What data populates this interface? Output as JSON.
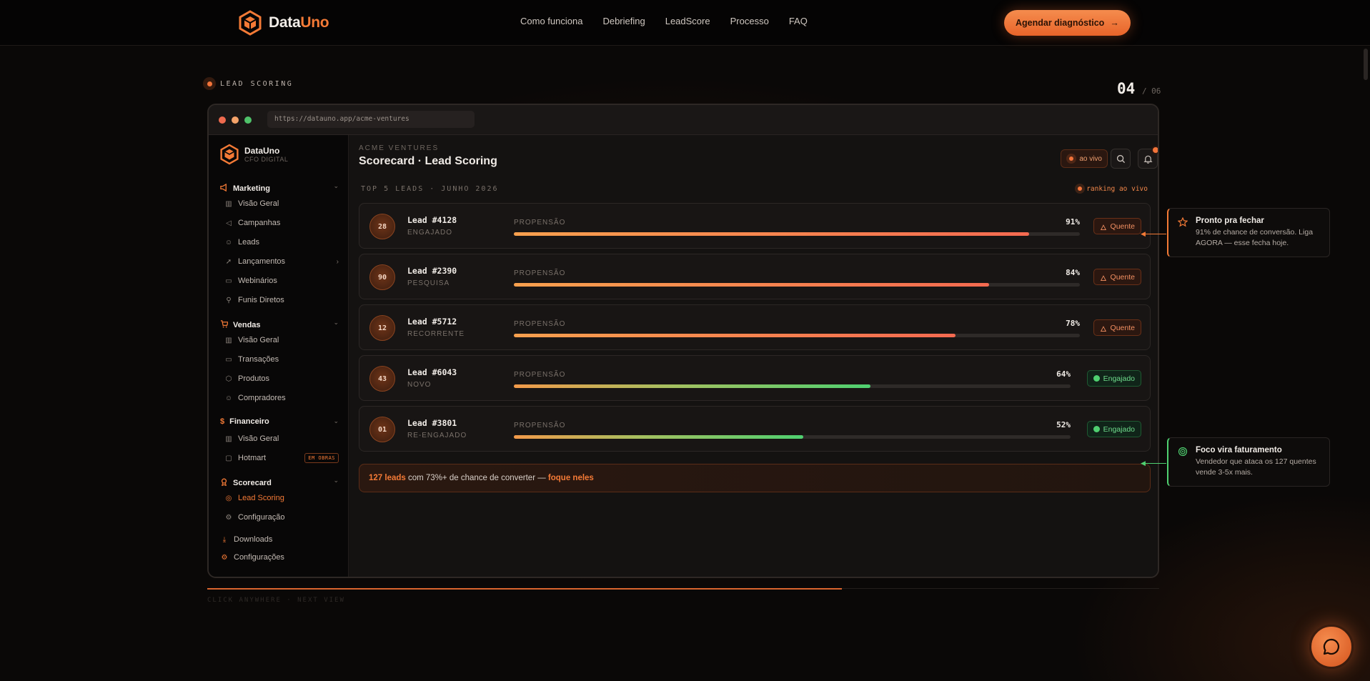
{
  "nav": {
    "brand_main": "Data",
    "brand_accent": "Uno",
    "links": [
      "Como funciona",
      "Debriefing",
      "LeadScore",
      "Processo",
      "FAQ"
    ],
    "cta_label": "Agendar diagnóstico",
    "cta_icon": "arrow-right-icon"
  },
  "section": {
    "tag": "LEAD SCORING",
    "step_current": "04",
    "step_total": "/ 06"
  },
  "browser": {
    "url": "https://datauno.app/acme-ventures"
  },
  "sidebar": {
    "brand_name": "DataUno",
    "brand_sub": "CFO DIGITAL",
    "groups": [
      {
        "label": "Marketing",
        "items": [
          "Visão Geral",
          "Campanhas",
          "Leads",
          "Lançamentos",
          "Webinários",
          "Funis Diretos"
        ]
      },
      {
        "label": "Vendas",
        "items": [
          "Visão Geral",
          "Transações",
          "Produtos",
          "Compradores"
        ]
      },
      {
        "label": "Financeiro",
        "items": [
          "Visão Geral",
          "Hotmart"
        ],
        "badge": "EM OBRAS"
      },
      {
        "label": "Scorecard",
        "items": [
          "Lead Scoring",
          "Configuração"
        ],
        "active": "Lead Scoring"
      }
    ],
    "footer": [
      "Downloads",
      "Configurações"
    ]
  },
  "main": {
    "eyebrow": "ACME VENTURES",
    "title": "Scorecard · Lead Scoring",
    "live_label": "ao vivo",
    "list_head": "TOP 5 LEADS · JUNHO 2026",
    "ranking_tag": "ranking ao vivo",
    "prop_label": "PROPENSÃO",
    "leads": [
      {
        "score": "28",
        "name": "Lead #4128",
        "stage": "ENGAJADO",
        "pct": "91%",
        "value": 91,
        "tag": "Quente",
        "kind": "hot"
      },
      {
        "score": "90",
        "name": "Lead #2390",
        "stage": "PESQUISA",
        "pct": "84%",
        "value": 84,
        "tag": "Quente",
        "kind": "hot"
      },
      {
        "score": "12",
        "name": "Lead #5712",
        "stage": "RECORRENTE",
        "pct": "78%",
        "value": 78,
        "tag": "Quente",
        "kind": "hot"
      },
      {
        "score": "43",
        "name": "Lead #6043",
        "stage": "NOVO",
        "pct": "64%",
        "value": 64,
        "tag": "Engajado",
        "kind": "eng"
      },
      {
        "score": "01",
        "name": "Lead #3801",
        "stage": "RE-ENGAJADO",
        "pct": "52%",
        "value": 52,
        "tag": "Engajado",
        "kind": "eng"
      }
    ],
    "summary": {
      "count": "127 leads",
      "middle": " com 73%+ de chance de converter — ",
      "action": "foque neles"
    }
  },
  "callouts": [
    {
      "title": "Pronto pra fechar",
      "text": "91% de chance de conversão. Liga AGORA — esse fecha hoje."
    },
    {
      "title": "Foco vira faturamento",
      "text": "Vendedor que ataca os 127 quentes vende 3-5x mais."
    }
  ],
  "hint": "CLICK ANYWHERE · NEXT VIEW",
  "progress": 0.667,
  "colors": {
    "accent": "#f47a36",
    "hot": "#f46a50",
    "engaged": "#4fd070"
  }
}
